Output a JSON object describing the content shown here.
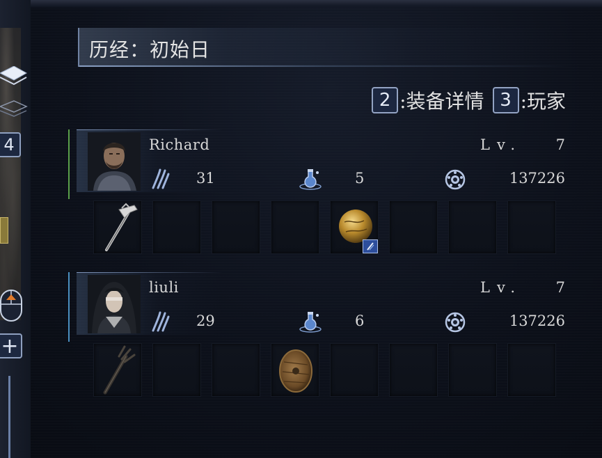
{
  "header": {
    "title": "历经：初始日"
  },
  "hints": [
    {
      "key": "2",
      "label": ":装备详情"
    },
    {
      "key": "3",
      "label": ":玩家"
    }
  ],
  "sidebar": {
    "key_4": "4",
    "plus_key": "+"
  },
  "players": [
    {
      "name": "Richard",
      "lv_label": "Lv.",
      "level": "7",
      "stat_claw": "31",
      "stat_flask": "5",
      "stat_runes": "137226",
      "accent": "#5aa04a",
      "slots": [
        "hammer-icon",
        "",
        "",
        "",
        "golden-orb-icon",
        "",
        "",
        ""
      ]
    },
    {
      "name": "liuli",
      "lv_label": "Lv.",
      "level": "7",
      "stat_claw": "29",
      "stat_flask": "6",
      "stat_runes": "137226",
      "accent": "#4a8fc0",
      "slots": [
        "spiked-club-icon",
        "",
        "",
        "round-shield-icon",
        "",
        "",
        "",
        ""
      ]
    }
  ],
  "colors": {
    "background": "#0b0f18",
    "keycap_border": "#93a3c3",
    "text": "#d8d8d8"
  }
}
